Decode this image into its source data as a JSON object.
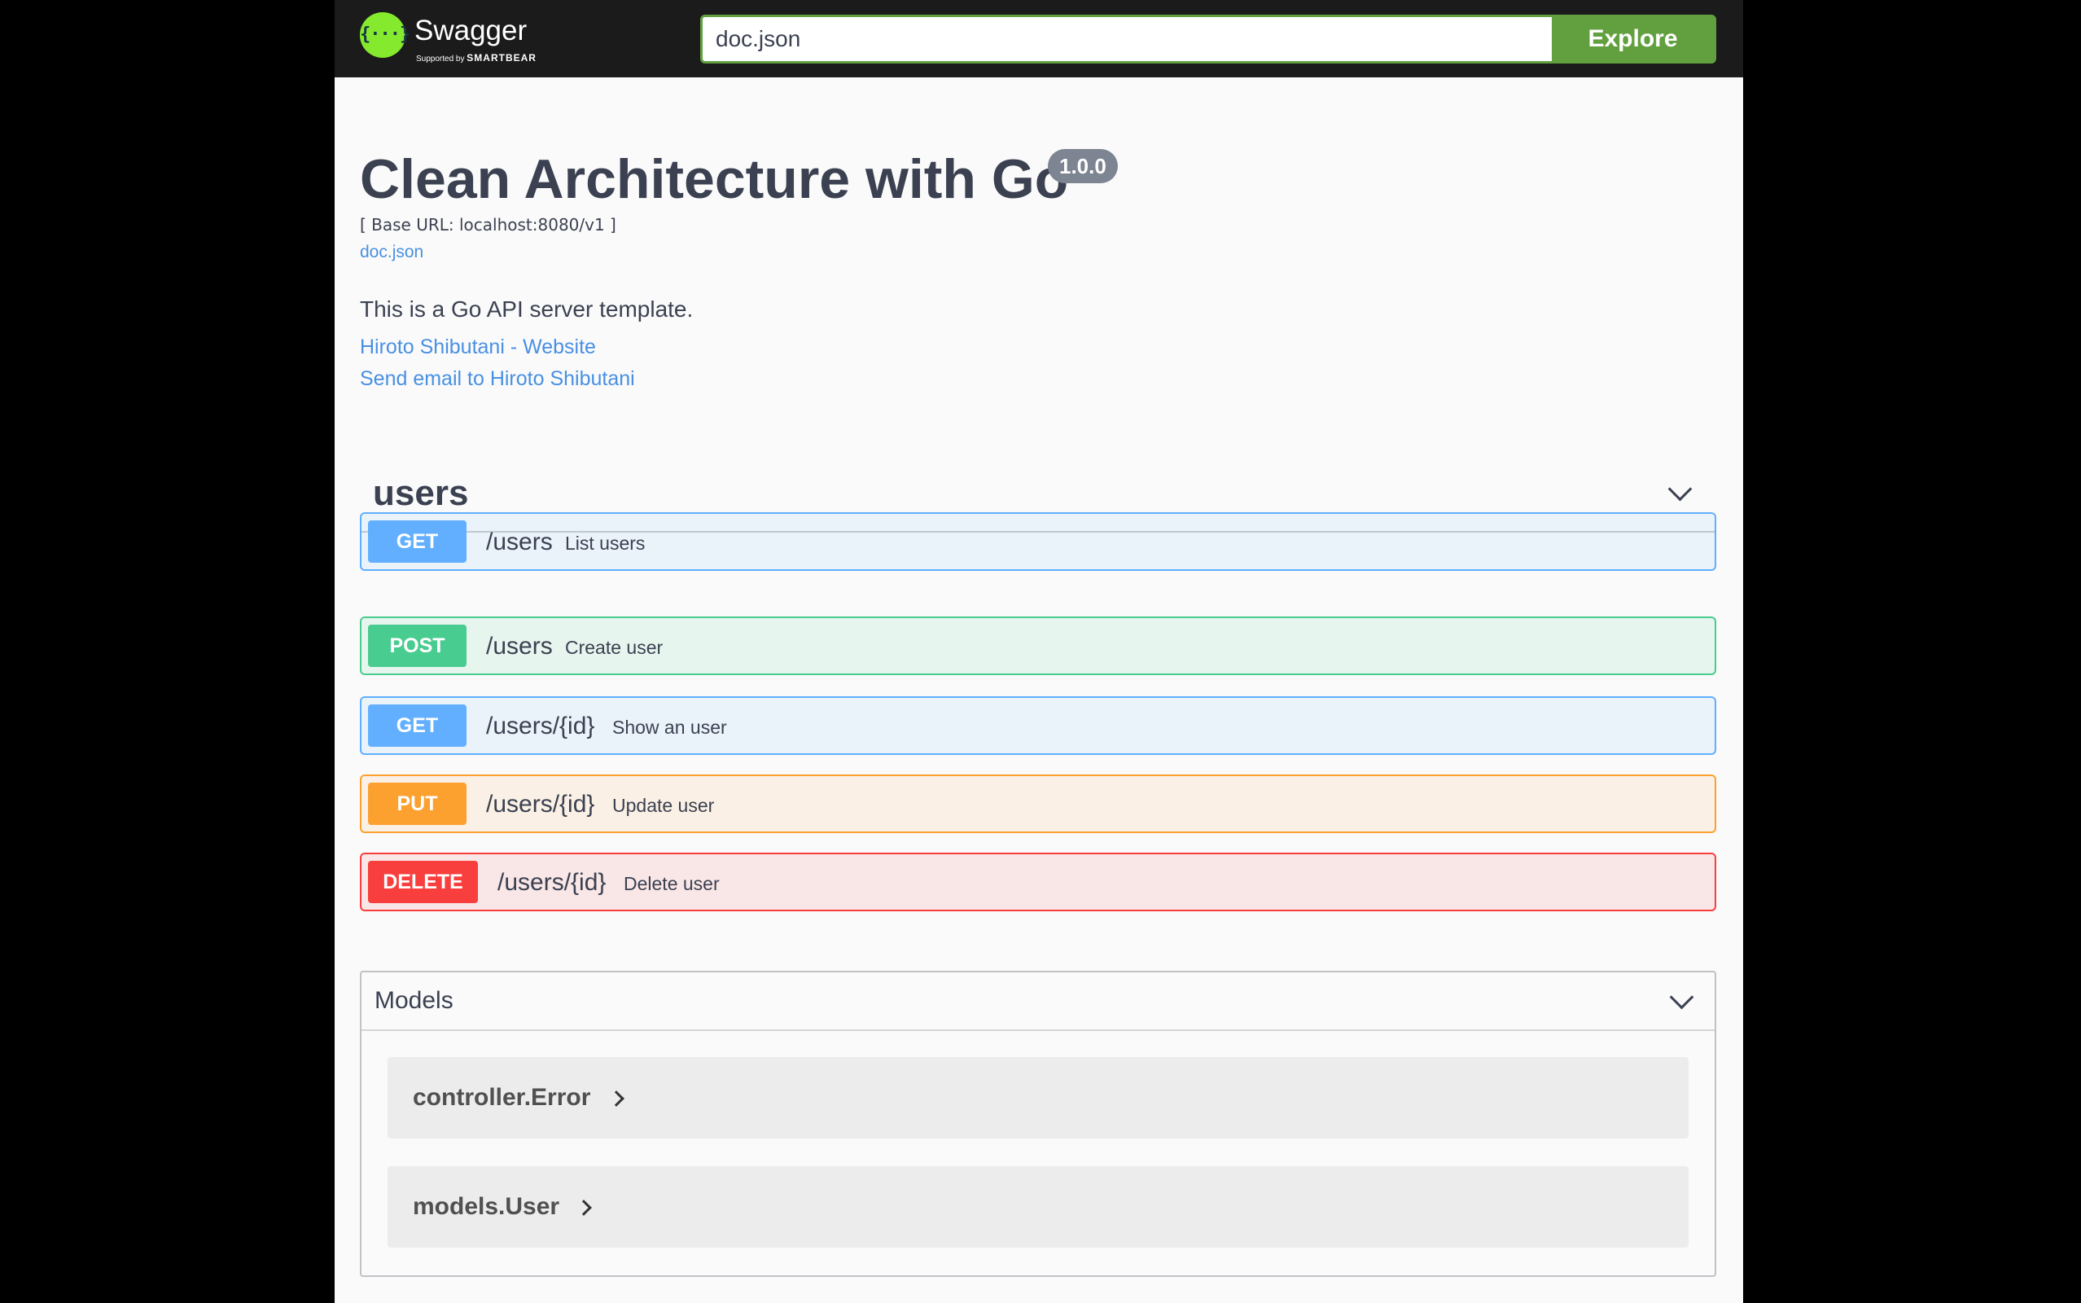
{
  "topbar": {
    "logo_icon": "{···}",
    "logo_name": "Swagger",
    "logo_sub_prefix": "Supported by",
    "logo_sub_brand": "SMARTBEAR",
    "search_value": "doc.json",
    "explore_label": "Explore"
  },
  "info": {
    "title": "Clean Architecture with Go",
    "version": "1.0.0",
    "base_url": "[ Base URL: localhost:8080/v1 ]",
    "spec_link": "doc.json",
    "description": "This is a Go API server template.",
    "website_link": "Hiroto Shibutani - Website",
    "email_link": "Send email to Hiroto Shibutani"
  },
  "tag": {
    "name": "users",
    "chevron_icon": "chevron-down-icon"
  },
  "operations": [
    {
      "method": "GET",
      "path": "/users",
      "summary": "List users"
    },
    {
      "method": "POST",
      "path": "/users",
      "summary": "Create user"
    },
    {
      "method": "GET",
      "path": "/users/{id}",
      "summary": "Show an user"
    },
    {
      "method": "PUT",
      "path": "/users/{id}",
      "summary": "Update user"
    },
    {
      "method": "DELETE",
      "path": "/users/{id}",
      "summary": "Delete user"
    }
  ],
  "models": {
    "title": "Models",
    "items": [
      {
        "name": "controller.Error"
      },
      {
        "name": "models.User"
      }
    ]
  },
  "colors": {
    "get": "#61affe",
    "post": "#49cc90",
    "put": "#fca130",
    "delete": "#f93e3e",
    "explore": "#62a03f",
    "link": "#4990e2"
  }
}
